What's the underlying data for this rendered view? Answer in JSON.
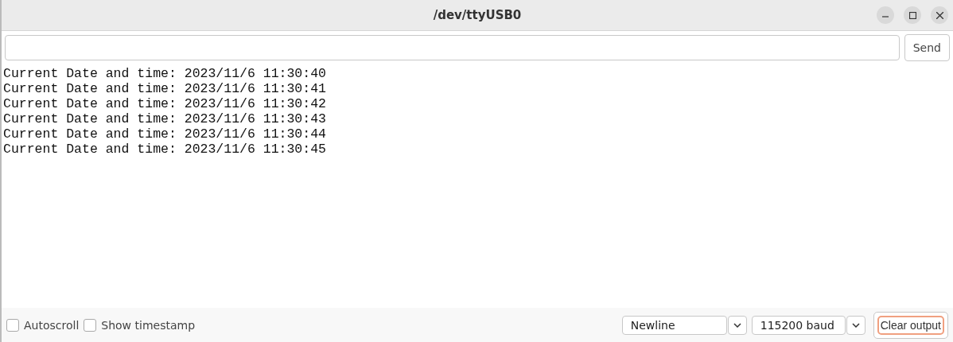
{
  "window": {
    "title": "/dev/ttyUSB0"
  },
  "send_button": {
    "label": "Send"
  },
  "output_lines": [
    "Current Date and time: 2023/11/6 11:30:40",
    "Current Date and time: 2023/11/6 11:30:41",
    "Current Date and time: 2023/11/6 11:30:42",
    "Current Date and time: 2023/11/6 11:30:43",
    "Current Date and time: 2023/11/6 11:30:44",
    "Current Date and time: 2023/11/6 11:30:45"
  ],
  "options": [
    {
      "label": "Autoscroll",
      "checked": false
    },
    {
      "label": "Show timestamp",
      "checked": false
    }
  ],
  "line_ending": {
    "value": "Newline"
  },
  "baud_rate": {
    "value": "115200 baud"
  },
  "clear_button": {
    "label": "Clear output",
    "focused": true
  }
}
